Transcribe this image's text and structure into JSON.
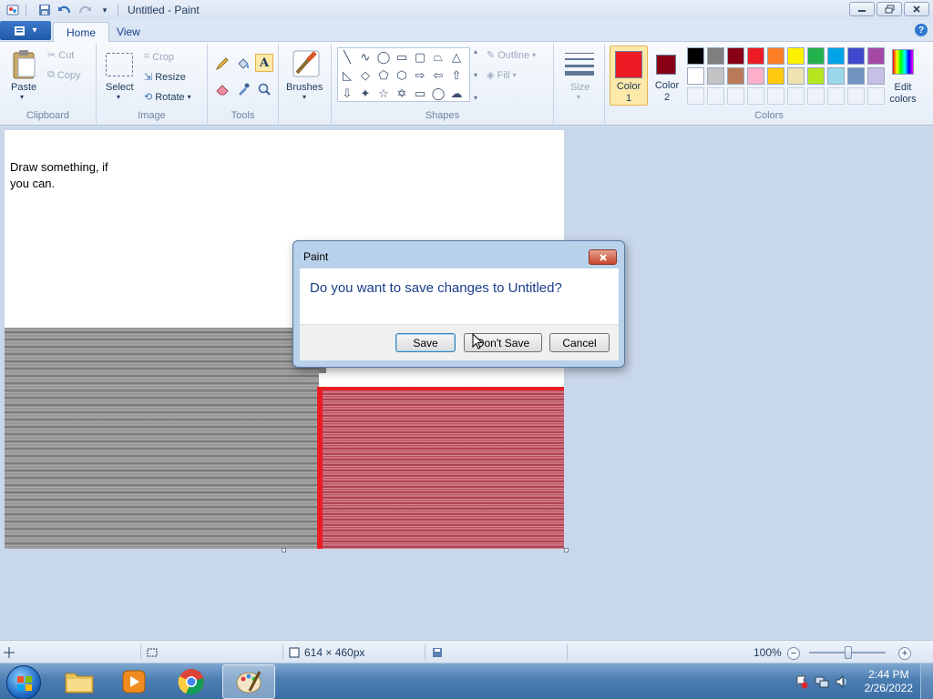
{
  "window": {
    "title": "Untitled - Paint"
  },
  "tabs": {
    "home": "Home",
    "view": "View"
  },
  "clipboard": {
    "paste": "Paste",
    "cut": "Cut",
    "copy": "Copy",
    "label": "Clipboard"
  },
  "image": {
    "select": "Select",
    "crop": "Crop",
    "resize": "Resize",
    "rotate": "Rotate",
    "label": "Image"
  },
  "tools": {
    "label": "Tools"
  },
  "brushes": {
    "label": "Brushes"
  },
  "shapes": {
    "outline": "Outline",
    "fill": "Fill",
    "label": "Shapes"
  },
  "size": {
    "label": "Size"
  },
  "colors": {
    "color1_line1": "Color",
    "color1_line2": "1",
    "color2_line1": "Color",
    "color2_line2": "2",
    "edit_line1": "Edit",
    "edit_line2": "colors",
    "label": "Colors",
    "color1": "#ed1c24",
    "color2": "#880015",
    "palette_row1": [
      "#000000",
      "#7f7f7f",
      "#880015",
      "#ed1c24",
      "#ff7f27",
      "#fff200",
      "#22b14c",
      "#00a2e8",
      "#3f48cc",
      "#a349a4"
    ],
    "palette_row2": [
      "#ffffff",
      "#c3c3c3",
      "#b97a57",
      "#ffaec9",
      "#ffc90e",
      "#efe4b0",
      "#b5e61d",
      "#99d9ea",
      "#7092be",
      "#c8bfe7"
    ]
  },
  "canvas": {
    "text": "Draw something, if you can."
  },
  "dialog": {
    "title": "Paint",
    "message": "Do you want to save changes to Untitled?",
    "save": "Save",
    "dont_save": "Don't Save",
    "cancel": "Cancel"
  },
  "status": {
    "dimensions": "614 × 460px",
    "zoom": "100%"
  },
  "taskbar": {
    "time": "2:44 PM",
    "date": "2/26/2022"
  }
}
